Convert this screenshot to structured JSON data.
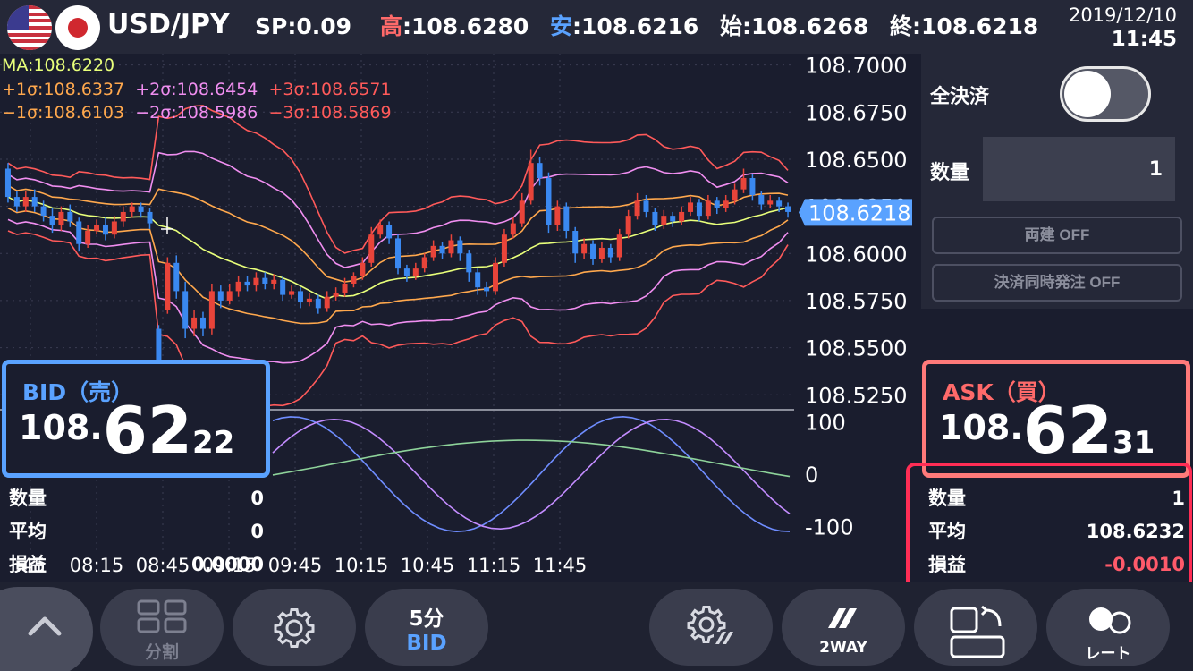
{
  "header": {
    "symbol": "USD/JPY",
    "sp_label": "SP",
    "sp_value": ":0.09",
    "high_label": "高",
    "high_value": ":108.6280",
    "low_label": "安",
    "low_value": ":108.6216",
    "open_label": "始",
    "open_value": ":108.6268",
    "close_label": "終",
    "close_value": ":108.6218",
    "date": "2019/12/10",
    "time": "11:45"
  },
  "indicators": {
    "ma": "MA:108.6220",
    "plus1": "+1σ:108.6337",
    "plus2": "+2σ:108.6454",
    "plus3": "+3σ:108.6571",
    "minus1": "−1σ:108.6103",
    "minus2": "−2σ:108.5986",
    "minus3": "−3σ:108.5869"
  },
  "chart_data": {
    "type": "candlestick",
    "y_ticks": [
      "108.7000",
      "108.6750",
      "108.6500",
      "108.6250",
      "108.6000",
      "108.5750",
      "108.5500",
      "108.5250"
    ],
    "ylim": [
      108.518,
      108.706
    ],
    "current_price": "108.6218",
    "x_ticks": [
      ":45",
      "08:15",
      "08:45",
      "09:15",
      "09:45",
      "10:15",
      "10:45",
      "11:15",
      "11:45"
    ],
    "oscillator_ticks": [
      "100",
      "0",
      "-100"
    ],
    "oscillator_range": [
      -120,
      120
    ],
    "candles": [
      [
        108.645,
        108.63,
        108.648,
        108.627
      ],
      [
        108.63,
        108.625,
        108.633,
        108.622
      ],
      [
        108.625,
        108.63,
        108.633,
        108.622
      ],
      [
        108.63,
        108.625,
        108.634,
        108.622
      ],
      [
        108.625,
        108.62,
        108.628,
        108.617
      ],
      [
        108.62,
        108.615,
        108.624,
        108.611
      ],
      [
        108.615,
        108.622,
        108.625,
        108.612
      ],
      [
        108.622,
        108.617,
        108.626,
        108.614
      ],
      [
        108.617,
        108.605,
        108.619,
        108.601
      ],
      [
        108.605,
        108.612,
        108.615,
        108.603
      ],
      [
        108.612,
        108.615,
        108.618,
        108.61
      ],
      [
        108.615,
        108.61,
        108.619,
        108.607
      ],
      [
        108.61,
        108.617,
        108.62,
        108.608
      ],
      [
        108.617,
        108.622,
        108.625,
        108.614
      ],
      [
        108.622,
        108.625,
        108.627,
        108.619
      ],
      [
        108.625,
        108.622,
        108.627,
        108.619
      ],
      [
        108.622,
        108.616,
        108.624,
        108.613
      ],
      [
        108.56,
        108.54,
        108.562,
        108.535
      ],
      [
        108.57,
        108.595,
        108.598,
        108.568
      ],
      [
        108.595,
        108.58,
        108.599,
        108.576
      ],
      [
        108.58,
        108.56,
        108.585,
        108.555
      ],
      [
        108.56,
        108.566,
        108.57,
        108.556
      ],
      [
        108.566,
        108.56,
        108.569,
        108.556
      ],
      [
        108.56,
        108.58,
        108.584,
        108.557
      ],
      [
        108.58,
        108.575,
        108.583,
        108.571
      ],
      [
        108.575,
        108.58,
        108.584,
        108.573
      ],
      [
        108.58,
        108.585,
        108.588,
        108.577
      ],
      [
        108.585,
        108.583,
        108.588,
        108.58
      ],
      [
        108.583,
        108.587,
        108.59,
        108.58
      ],
      [
        108.587,
        108.584,
        108.59,
        108.581
      ],
      [
        108.584,
        108.586,
        108.589,
        108.581
      ],
      [
        108.586,
        108.578,
        108.588,
        108.575
      ],
      [
        108.578,
        108.58,
        108.583,
        108.576
      ],
      [
        108.58,
        108.574,
        108.582,
        108.571
      ],
      [
        108.574,
        108.576,
        108.579,
        108.572
      ],
      [
        108.576,
        108.571,
        108.578,
        108.568
      ],
      [
        108.571,
        108.577,
        108.58,
        108.569
      ],
      [
        108.577,
        108.579,
        108.582,
        108.575
      ],
      [
        108.579,
        108.584,
        108.587,
        108.577
      ],
      [
        108.584,
        108.588,
        108.59,
        108.582
      ],
      [
        108.588,
        108.595,
        108.598,
        108.586
      ],
      [
        108.595,
        108.61,
        108.614,
        108.593
      ],
      [
        108.61,
        108.615,
        108.618,
        108.608
      ],
      [
        108.615,
        108.608,
        108.617,
        108.605
      ],
      [
        108.608,
        108.592,
        108.61,
        108.589
      ],
      [
        108.592,
        108.588,
        108.594,
        108.585
      ],
      [
        108.588,
        108.592,
        108.595,
        108.586
      ],
      [
        108.592,
        108.598,
        108.6,
        108.59
      ],
      [
        108.598,
        108.604,
        108.607,
        108.596
      ],
      [
        108.604,
        108.6,
        108.606,
        108.597
      ],
      [
        108.6,
        108.607,
        108.61,
        108.598
      ],
      [
        108.607,
        108.6,
        108.609,
        108.596
      ],
      [
        108.6,
        108.59,
        108.602,
        108.585
      ],
      [
        108.59,
        108.582,
        108.592,
        108.578
      ],
      [
        108.582,
        108.58,
        108.585,
        108.577
      ],
      [
        108.58,
        108.595,
        108.598,
        108.578
      ],
      [
        108.595,
        108.61,
        108.613,
        108.593
      ],
      [
        108.61,
        108.616,
        108.619,
        108.608
      ],
      [
        108.616,
        108.628,
        108.632,
        108.614
      ],
      [
        108.628,
        108.648,
        108.655,
        108.626
      ],
      [
        108.648,
        108.64,
        108.651,
        108.636
      ],
      [
        108.64,
        108.615,
        108.643,
        108.611
      ],
      [
        108.615,
        108.625,
        108.628,
        108.612
      ],
      [
        108.625,
        108.612,
        108.627,
        108.608
      ],
      [
        108.612,
        108.6,
        108.614,
        108.595
      ],
      [
        108.6,
        108.605,
        108.608,
        108.597
      ],
      [
        108.605,
        108.597,
        108.607,
        108.594
      ],
      [
        108.597,
        108.603,
        108.606,
        108.595
      ],
      [
        108.603,
        108.598,
        108.605,
        108.595
      ],
      [
        108.598,
        108.61,
        108.613,
        108.596
      ],
      [
        108.61,
        108.62,
        108.623,
        108.608
      ],
      [
        108.62,
        108.628,
        108.632,
        108.618
      ],
      [
        108.628,
        108.622,
        108.631,
        108.619
      ],
      [
        108.622,
        108.615,
        108.624,
        108.612
      ],
      [
        108.615,
        108.62,
        108.623,
        108.613
      ],
      [
        108.62,
        108.617,
        108.622,
        108.614
      ],
      [
        108.617,
        108.622,
        108.625,
        108.615
      ],
      [
        108.622,
        108.627,
        108.63,
        108.62
      ],
      [
        108.627,
        108.62,
        108.629,
        108.617
      ],
      [
        108.62,
        108.628,
        108.631,
        108.618
      ],
      [
        108.628,
        108.624,
        108.63,
        108.621
      ],
      [
        108.624,
        108.628,
        108.631,
        108.622
      ],
      [
        108.628,
        108.634,
        108.637,
        108.626
      ],
      [
        108.634,
        108.64,
        108.645,
        108.632
      ],
      [
        108.64,
        108.631,
        108.642,
        108.628
      ],
      [
        108.631,
        108.626,
        108.633,
        108.623
      ],
      [
        108.626,
        108.628,
        108.631,
        108.624
      ],
      [
        108.628,
        108.625,
        108.63,
        108.622
      ],
      [
        108.625,
        108.622,
        108.627,
        108.619
      ]
    ]
  },
  "right_panel": {
    "close_all_label": "全決済",
    "quantity_label": "数量",
    "quantity_value": "1",
    "hedge_button": "両建 OFF",
    "simul_button": "決済同時発注 OFF"
  },
  "bid": {
    "title": "BID（売）",
    "price_int": "108.",
    "price_big": "62",
    "price_small": "22",
    "qty_label": "数量",
    "qty_value": "0",
    "avg_label": "平均",
    "avg_value": "0",
    "pl_label": "損益",
    "pl_value": "0.0000"
  },
  "ask": {
    "title": "ASK（買）",
    "price_int": "108.",
    "price_big": "62",
    "price_small": "31",
    "qty_label": "数量",
    "qty_value": "1",
    "avg_label": "平均",
    "avg_value": "108.6232",
    "pl_label": "損益",
    "pl_value": "-0.0010"
  },
  "toolbar": {
    "split_label": "分割",
    "timeframe": "5分",
    "side": "BID",
    "twoway_label": "2WAY",
    "rate_label": "レート"
  },
  "colors": {
    "bid_blue": "#5aa2ff",
    "ask_red": "#ff6a6a",
    "highlight": "#ff2d55",
    "candle_up": "#e8443a",
    "candle_down": "#3a88f0"
  }
}
